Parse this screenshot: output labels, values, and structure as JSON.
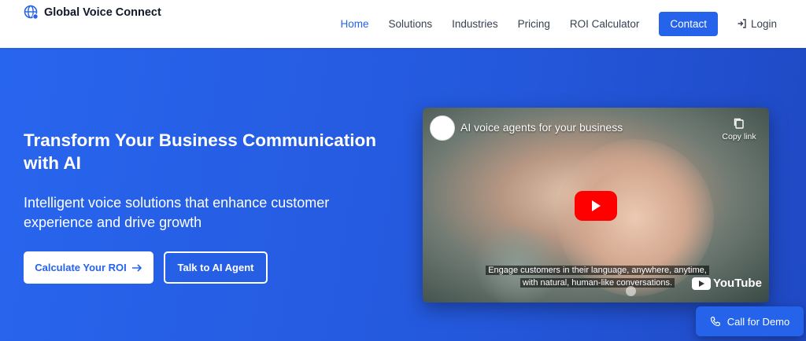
{
  "brand": {
    "name": "Global Voice Connect",
    "icon": "globe-icon"
  },
  "nav": {
    "items": [
      {
        "label": "Home",
        "active": true
      },
      {
        "label": "Solutions"
      },
      {
        "label": "Industries"
      },
      {
        "label": "Pricing"
      },
      {
        "label": "ROI Calculator"
      }
    ],
    "contact_label": "Contact",
    "login_label": "Login"
  },
  "hero": {
    "title": "Transform Your Business Communication with AI",
    "subtitle": "Intelligent voice solutions that enhance customer experience and drive growth",
    "primary_button": "Calculate Your ROI",
    "secondary_button": "Talk to AI Agent"
  },
  "video": {
    "title": "AI voice agents for your business",
    "copy_label": "Copy link",
    "caption_line1": "Engage customers in their language, anywhere, anytime,",
    "caption_line2": "with natural, human-like conversations.",
    "platform_label": "YouTube"
  },
  "floating": {
    "call_label": "Call for Demo"
  },
  "colors": {
    "primary": "#2563eb",
    "hero": "#2663e8",
    "youtube_red": "#ff0000"
  }
}
